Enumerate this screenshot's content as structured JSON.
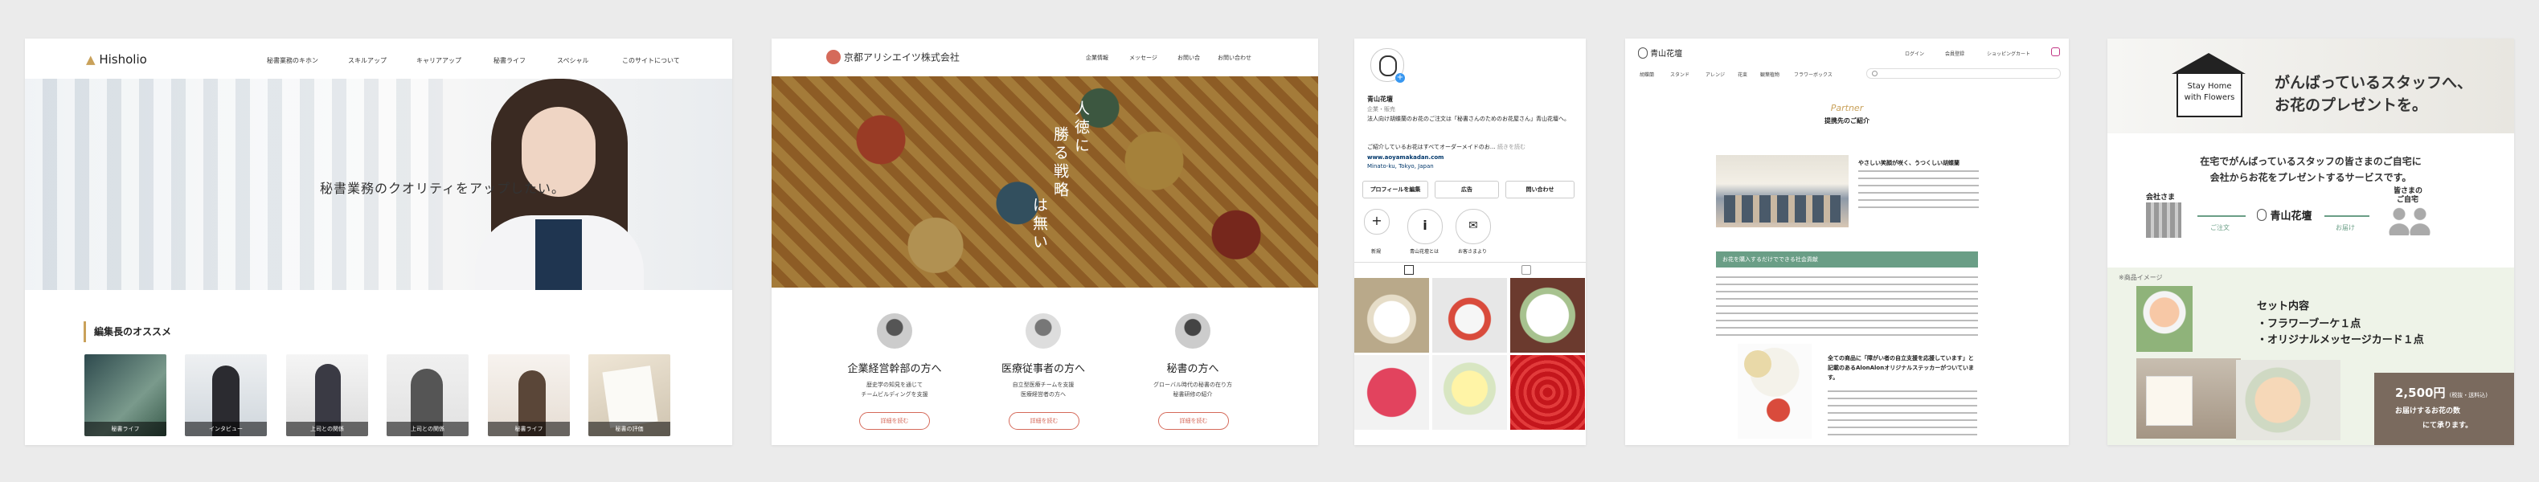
{
  "card1": {
    "logo": "Hisholio",
    "nav": [
      "秘書業務のキホン",
      "スキルアップ",
      "キャリアアップ",
      "秘書ライフ",
      "スペシャル",
      "このサイトについて"
    ],
    "hero_text": "秘書業務のクオリティをアップしたい。",
    "section_title": "編集長のオススメ",
    "thumbs": [
      "秘書ライフ",
      "インタビュー",
      "上司との関係",
      "上司との関係",
      "秘書ライフ",
      "秘書の評価"
    ]
  },
  "card2": {
    "logo_text": "京都アリシエイツ株式会社",
    "nav": [
      "企業情報",
      "メッセージ",
      "お問い合",
      "お問い合わせ"
    ],
    "hero_lines": [
      "人徳に",
      "勝る戦略",
      "は無い"
    ],
    "cols": [
      {
        "title": "企業経営幹部の方へ",
        "desc1": "歴史学の知見を通じて",
        "desc2": "チームビルディングを支援",
        "btn": "詳細を読む"
      },
      {
        "title": "医療従事者の方へ",
        "desc1": "自立型医療チームを支援",
        "desc2": "医療経営者の方へ",
        "btn": "詳細を読む"
      },
      {
        "title": "秘書の方へ",
        "desc1": "グローバル時代の秘書の在り方",
        "desc2": "秘書研修の紹介",
        "btn": "詳細を読む"
      }
    ]
  },
  "card3": {
    "name": "青山花壇",
    "category": "企業・販売",
    "bio1": "法人向け胡蝶蘭のお花のご注文は「秘書さんのためのお花屋さん」青山花壇へ。",
    "bio2": "ご紹介しているお花はすべてオーダーメイドのお…",
    "more": "続きを読む",
    "url": "www.aoyamakadan.com",
    "location": "Minato-ku, Tokyo, Japan",
    "buttons": [
      "プロフィールを編集",
      "広告",
      "問い合わせ"
    ],
    "highlights": [
      "新規",
      "青山花壇とは",
      "お客さまより"
    ]
  },
  "card4": {
    "logo": "青山花壇",
    "top_links": [
      "ログイン",
      "会員登録",
      "ショッピングカート"
    ],
    "nav": [
      "胡蝶蘭",
      "スタンド",
      "アレンジ",
      "花束",
      "観葉植物",
      "フラワーボックス"
    ],
    "partner_en": "Partner",
    "partner_jp": "提携先のご紹介",
    "intro_title": "やさしい笑顔が咲く、うつくしい胡蝶蘭",
    "banner": "お花を購入するだけでできる社会貢献",
    "cta_title": "全ての商品に「障がい者の自立支援を応援しています」と記載のあるAlonAlonオリジナルステッカーがついています。"
  },
  "card5": {
    "logo_line1": "Stay Home",
    "logo_line2": "with Flowers",
    "headline1": "がんばっているスタッフへ、",
    "headline2": "お花のプレゼントを。",
    "sub1": "在宅でがんばっているスタッフの皆さまのご自宅に",
    "sub2": "会社からお花をプレゼントするサービスです。",
    "flow_company": "会社さま",
    "flow_order": "ご注文",
    "flow_brand": "青山花壇",
    "flow_deliver": "お届け",
    "flow_staff1": "皆さまの",
    "flow_staff2": "ご自宅",
    "product_label": "※商品イメージ",
    "set_title": "セット内容",
    "set_item1": "・フラワーブーケ１点",
    "set_item2": "・オリジナルメッセージカード１点",
    "price": "2,500円",
    "price_note": "(税抜・送料込)",
    "price_desc1": "お届けするお花の数",
    "price_desc2": "にて承ります。"
  },
  "colors": {
    "accent_red": "#d56a5a",
    "green": "#6a9e86",
    "brown": "#7a6a5e"
  }
}
